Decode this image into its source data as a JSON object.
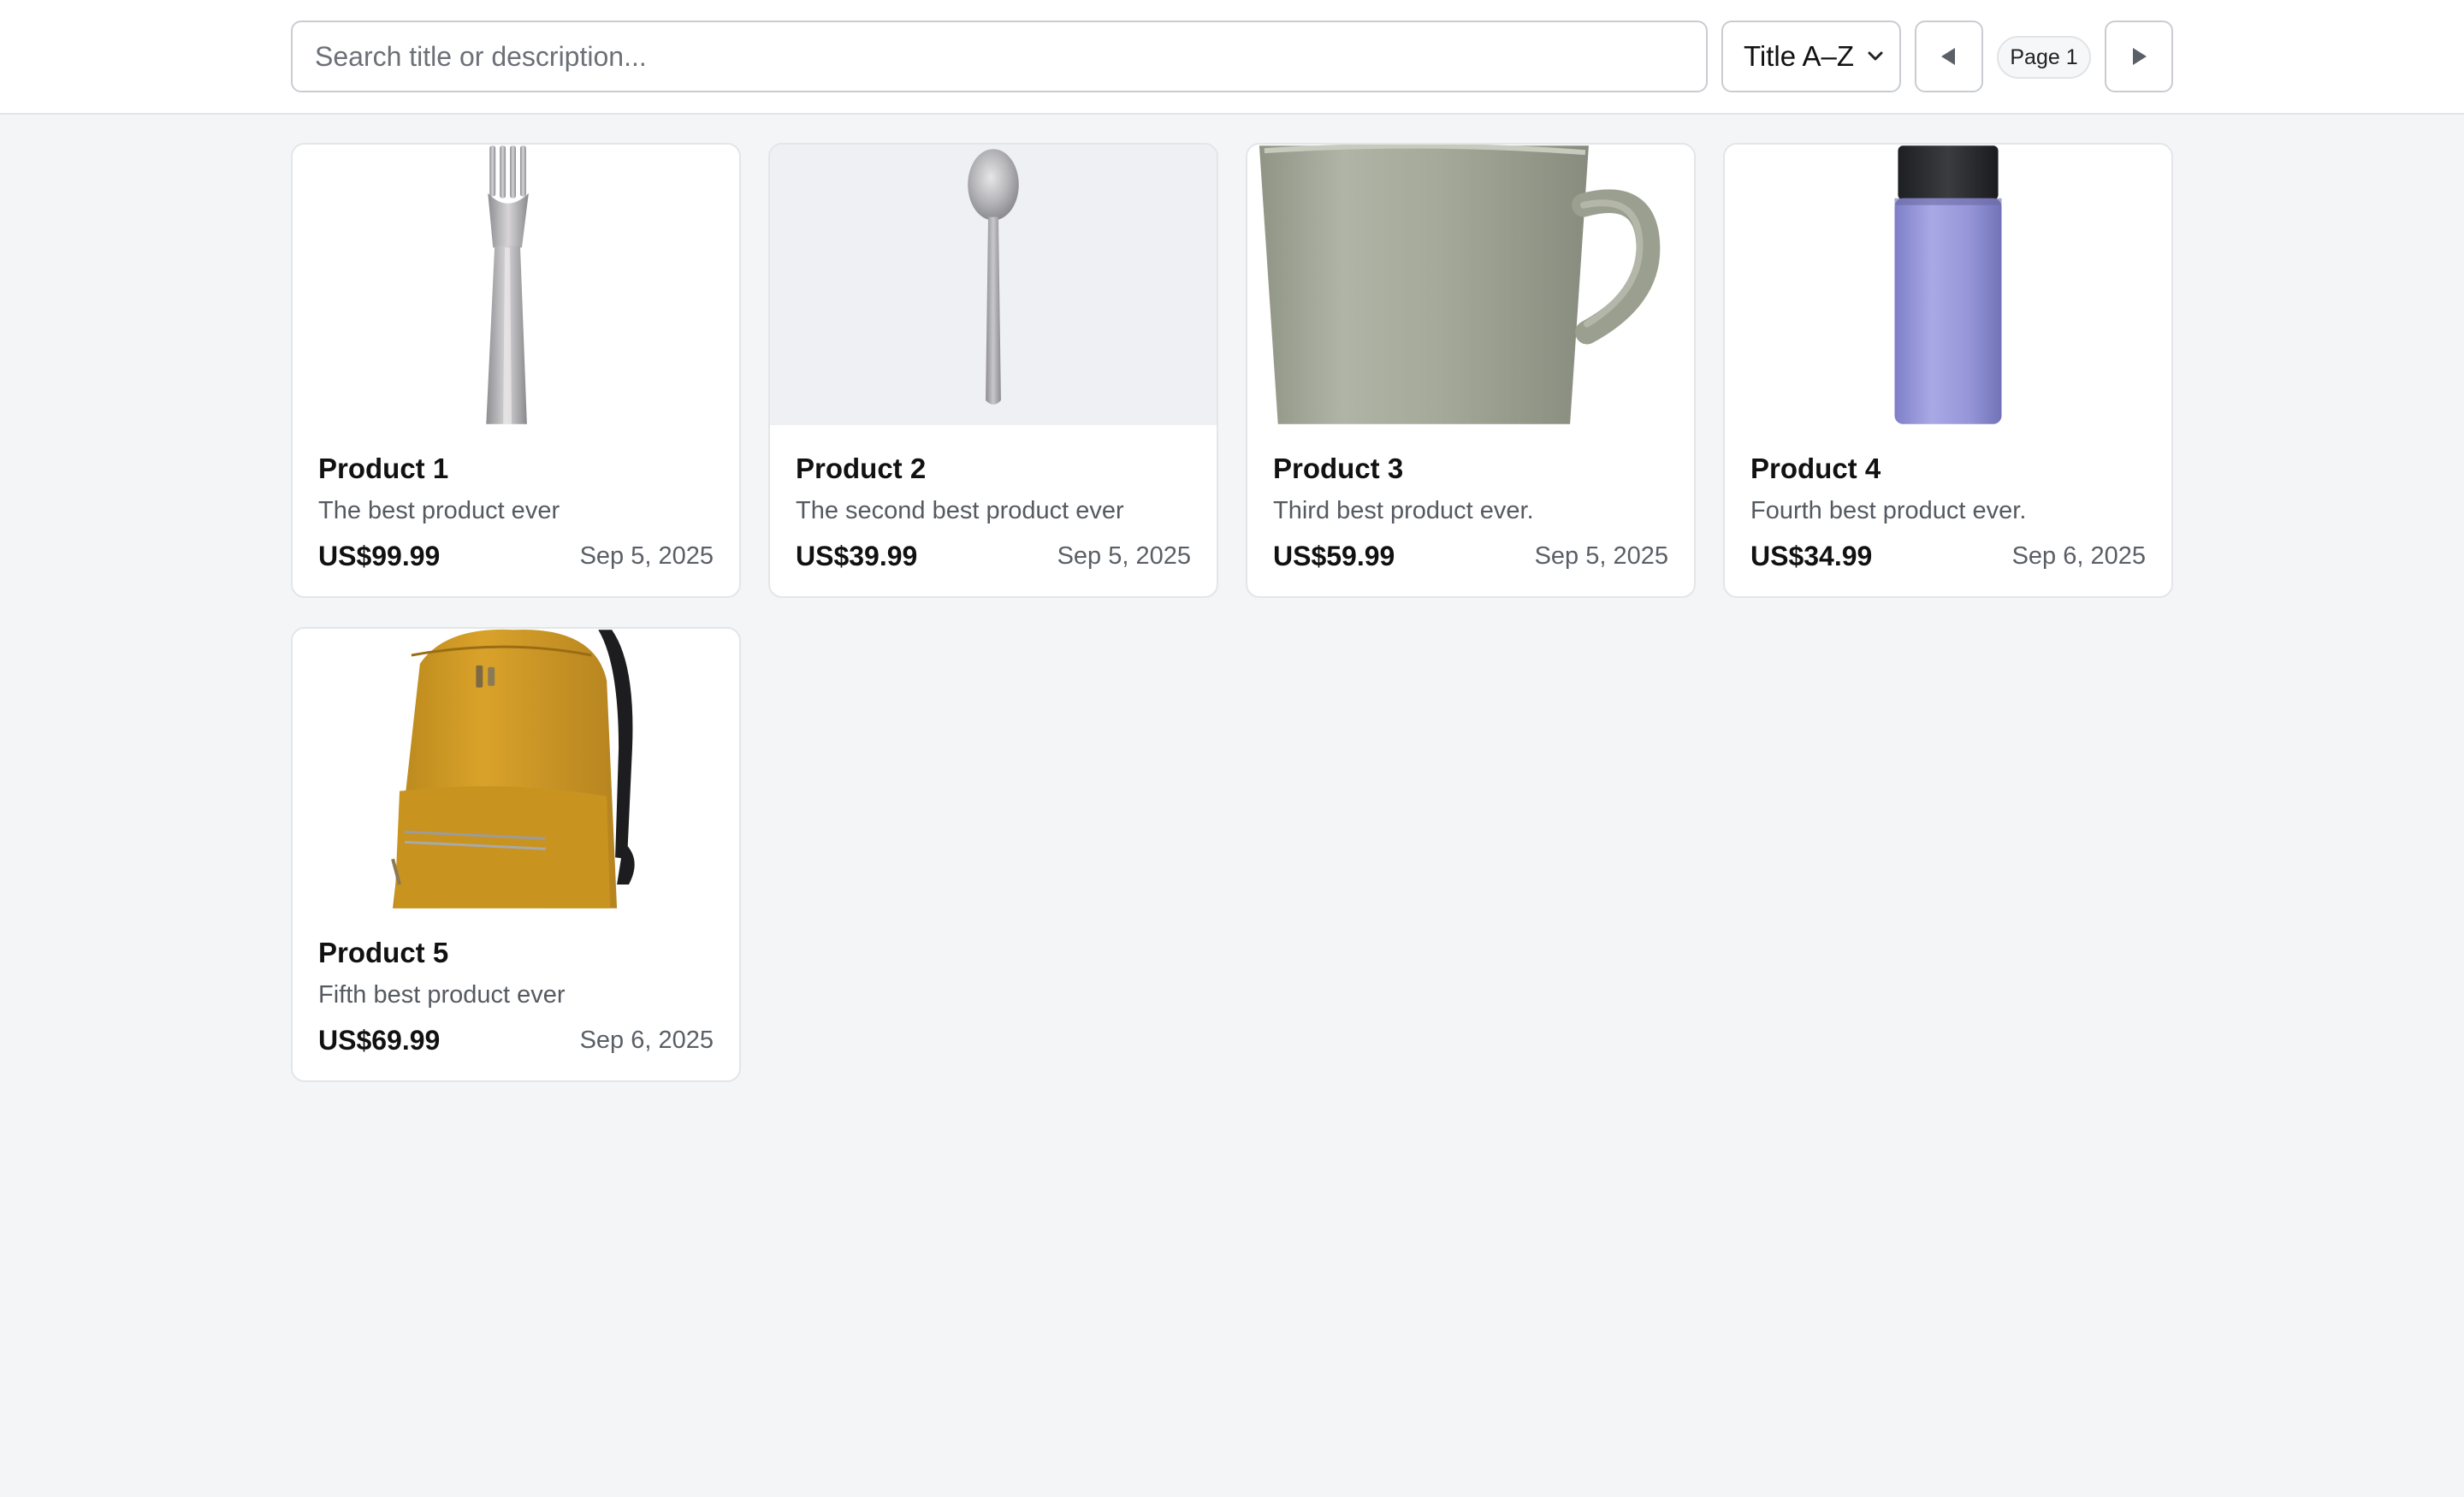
{
  "toolbar": {
    "search_placeholder": "Search title or description...",
    "search_value": "",
    "sort_selected": "Title A–Z",
    "prev_icon": "triangle-left-icon",
    "next_icon": "triangle-right-icon",
    "page_label": "Page 1"
  },
  "products": [
    {
      "title": "Product 1",
      "description": "The best product ever",
      "price": "US$99.99",
      "date": "Sep 5, 2025",
      "image": "fork"
    },
    {
      "title": "Product 2",
      "description": "The second best product ever",
      "price": "US$39.99",
      "date": "Sep 5, 2025",
      "image": "spoon"
    },
    {
      "title": "Product 3",
      "description": "Third best product ever.",
      "price": "US$59.99",
      "date": "Sep 5, 2025",
      "image": "mug"
    },
    {
      "title": "Product 4",
      "description": "Fourth best product ever.",
      "price": "US$34.99",
      "date": "Sep 6, 2025",
      "image": "water-bottle"
    },
    {
      "title": "Product 5",
      "description": "Fifth best product ever",
      "price": "US$69.99",
      "date": "Sep 6, 2025",
      "image": "backpack"
    }
  ],
  "colors": {
    "page_bg": "#f4f5f7",
    "card_bg": "#ffffff",
    "border": "#e3e5e8",
    "muted_text": "#555a61"
  }
}
